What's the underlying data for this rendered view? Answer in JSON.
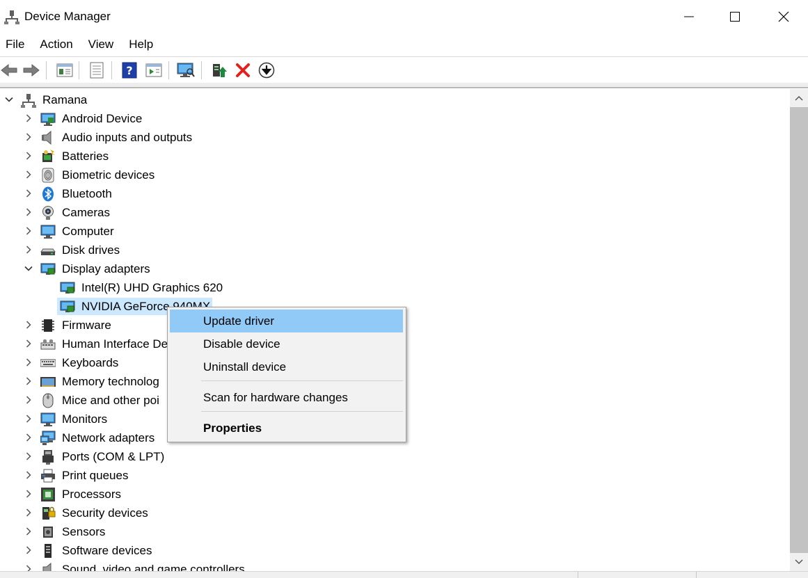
{
  "window": {
    "title": "Device Manager"
  },
  "menu": [
    "File",
    "Action",
    "View",
    "Help"
  ],
  "tree": {
    "root": "Ramana",
    "items": [
      {
        "label": "Android Device",
        "icon": "monitor-icon",
        "expanded": false
      },
      {
        "label": "Audio inputs and outputs",
        "icon": "speaker-icon",
        "expanded": false
      },
      {
        "label": "Batteries",
        "icon": "battery-icon",
        "expanded": false
      },
      {
        "label": "Biometric devices",
        "icon": "fingerprint-icon",
        "expanded": false
      },
      {
        "label": "Bluetooth",
        "icon": "bluetooth-icon",
        "expanded": false
      },
      {
        "label": "Cameras",
        "icon": "webcam-icon",
        "expanded": false
      },
      {
        "label": "Computer",
        "icon": "computer-icon",
        "expanded": false
      },
      {
        "label": "Disk drives",
        "icon": "disk-drive-icon",
        "expanded": false
      },
      {
        "label": "Display adapters",
        "icon": "display-adapter-icon",
        "expanded": true
      },
      {
        "label": "Intel(R) UHD Graphics 620",
        "icon": "display-adapter-icon",
        "child": true
      },
      {
        "label": "NVIDIA GeForce 940MX",
        "icon": "display-adapter-icon",
        "child": true,
        "selected": true
      },
      {
        "label": "Firmware",
        "icon": "firmware-icon",
        "expanded": false
      },
      {
        "label": "Human Interface De",
        "icon": "hid-icon",
        "expanded": false
      },
      {
        "label": "Keyboards",
        "icon": "keyboard-icon",
        "expanded": false
      },
      {
        "label": "Memory technolog",
        "icon": "memory-icon",
        "expanded": false
      },
      {
        "label": "Mice and other poi",
        "icon": "mouse-icon",
        "expanded": false
      },
      {
        "label": "Monitors",
        "icon": "monitor-icon",
        "expanded": false
      },
      {
        "label": "Network adapters",
        "icon": "network-icon",
        "expanded": false
      },
      {
        "label": "Ports (COM & LPT)",
        "icon": "port-icon",
        "expanded": false
      },
      {
        "label": "Print queues",
        "icon": "printer-icon",
        "expanded": false
      },
      {
        "label": "Processors",
        "icon": "processor-icon",
        "expanded": false
      },
      {
        "label": "Security devices",
        "icon": "security-icon",
        "expanded": false
      },
      {
        "label": "Sensors",
        "icon": "sensor-icon",
        "expanded": false
      },
      {
        "label": "Software devices",
        "icon": "software-icon",
        "expanded": false
      },
      {
        "label": "Sound, video and game controllers",
        "icon": "speaker-icon",
        "expanded": false
      }
    ]
  },
  "context_menu": {
    "update": "Update driver",
    "disable": "Disable device",
    "uninstall": "Uninstall device",
    "scan": "Scan for hardware changes",
    "properties": "Properties"
  },
  "colors": {
    "highlight": "#91c9f7",
    "selection": "#cce8ff",
    "accent_green": "#1c8a3c",
    "uninstall_red": "#e0211c"
  }
}
